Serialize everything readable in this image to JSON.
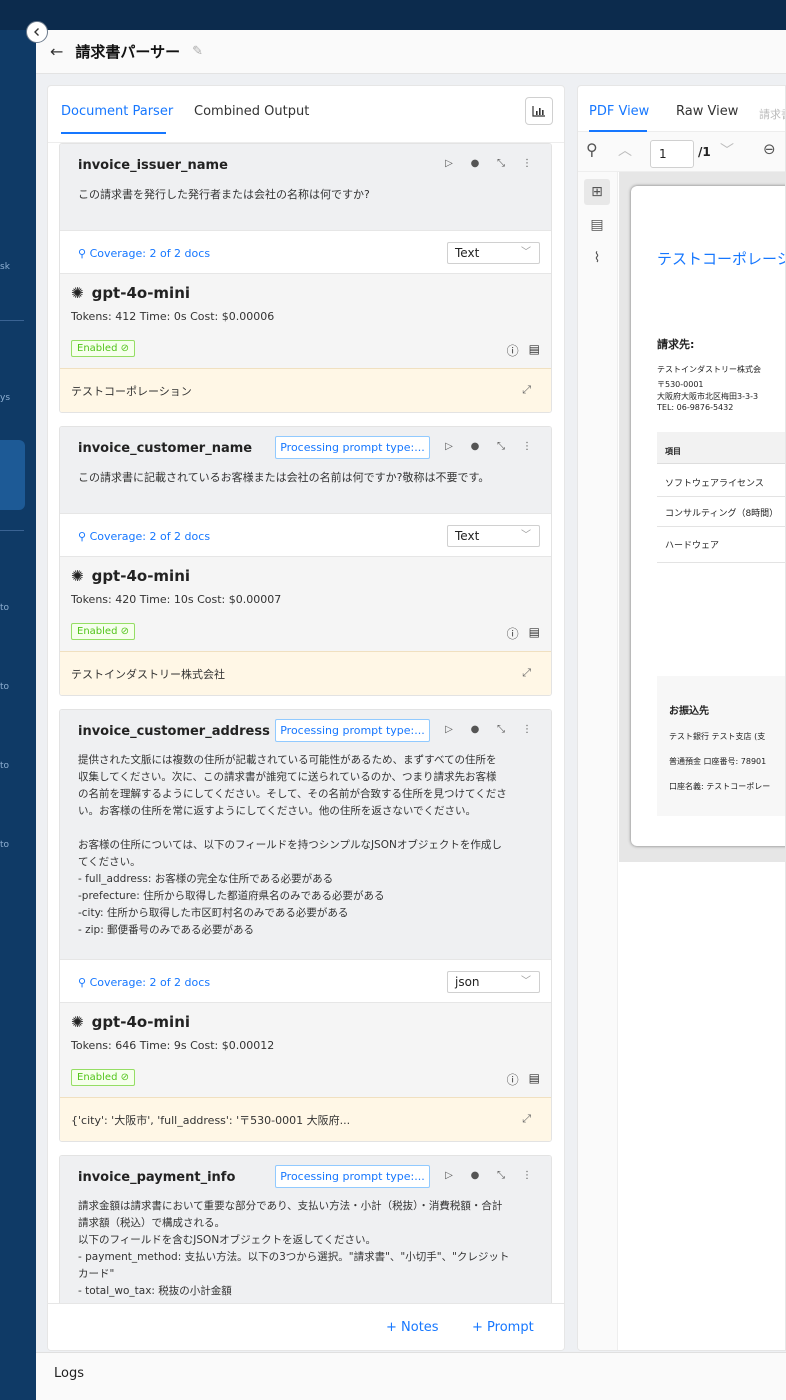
{
  "header": {
    "title": "請求書パーサー"
  },
  "sidebar": {
    "labels": [
      "sk",
      "ys",
      "to",
      "to",
      "to",
      "to"
    ]
  },
  "tabs": {
    "document_parser": "Document Parser",
    "combined_output": "Combined Output"
  },
  "cards": [
    {
      "name": "invoice_issuer_name",
      "prompt_type": "",
      "prompt": "この請求書を発行した発行者または会社の名称は何ですか?",
      "coverage": "Coverage: 2 of 2 docs",
      "output_type": "Text",
      "model": "gpt-4o-mini",
      "stats": "Tokens: 412   Time: 0s   Cost: $0.00006",
      "enabled": "Enabled",
      "result": "テストコーポレーション"
    },
    {
      "name": "invoice_customer_name",
      "prompt_type": "Processing prompt type:...",
      "prompt": "この請求書に記載されているお客様または会社の名前は何ですか?敬称は不要です。",
      "coverage": "Coverage: 2 of 2 docs",
      "output_type": "Text",
      "model": "gpt-4o-mini",
      "stats": "Tokens: 420   Time: 10s   Cost: $0.00007",
      "enabled": "Enabled",
      "result": "テストインダストリー株式会社"
    },
    {
      "name": "invoice_customer_address",
      "prompt_type": "Processing prompt type:...",
      "prompt": "提供された文脈には複数の住所が記載されている可能性があるため、まずすべての住所を\n収集してください。次に、この請求書が誰宛てに送られているのか、つまり請求先お客様\nの名前を理解するようにしてください。そして、その名前が合致する住所を見つけてくださ\nい。お客様の住所を常に返すようにしてください。他の住所を返さないでください。\n\nお客様の住所については、以下のフィールドを持つシンプルなJSONオブジェクトを作成し\nてください。\n- full_address: お客様の完全な住所である必要がある\n-prefecture: 住所から取得した都道府県名のみである必要がある\n-city: 住所から取得した市区町村名のみである必要がある\n- zip: 郵便番号のみである必要がある",
      "coverage": "Coverage: 2 of 2 docs",
      "output_type": "json",
      "model": "gpt-4o-mini",
      "stats": "Tokens: 646   Time: 9s   Cost: $0.00012",
      "enabled": "Enabled",
      "result": "{'city': '大阪市', 'full_address': '〒530-0001 大阪府..."
    },
    {
      "name": "invoice_payment_info",
      "prompt_type": "Processing prompt type:...",
      "prompt": "請求金額は請求書において重要な部分であり、支払い方法・小計（税抜）・消費税額・合計\n請求額（税込）で構成される。\n以下のフィールドを含むJSONオブジェクトを返してください。\n- payment_method: 支払い方法。以下の3つから選択。\"請求書\"、\"小切手\"、\"クレジット\nカード\"\n- total_wo_tax: 税抜の小計金額"
    }
  ],
  "actions": {
    "notes": "Notes",
    "prompt": "Prompt"
  },
  "right_tabs": {
    "pdf_view": "PDF View",
    "raw_view": "Raw View",
    "third": "請求書"
  },
  "viewer": {
    "page_input": "1",
    "page_total": "/1"
  },
  "pdf": {
    "company": "テストコーポレーシ",
    "bill_to_label": "請求先:",
    "bill_to_name": "テストインダストリー株式会",
    "zip": "〒530-0001",
    "address": "大阪府大阪市北区梅田3-3-3",
    "tel": "TEL: 06-9876-5432",
    "items_header": "項目",
    "items": [
      "ソフトウェアライセンス",
      "コンサルティング（8時間）",
      "ハードウェア"
    ],
    "bank_label": "お振込先",
    "bank_lines": [
      "テスト銀行 テスト支店 (支",
      "普通預金 口座番号: 78901",
      "口座名義: テストコーポレー"
    ]
  },
  "logs": {
    "label": "Logs"
  },
  "colors": {
    "accent": "#1677ff",
    "sidebar": "#0f3a66",
    "result_bg": "#fff7e6"
  }
}
